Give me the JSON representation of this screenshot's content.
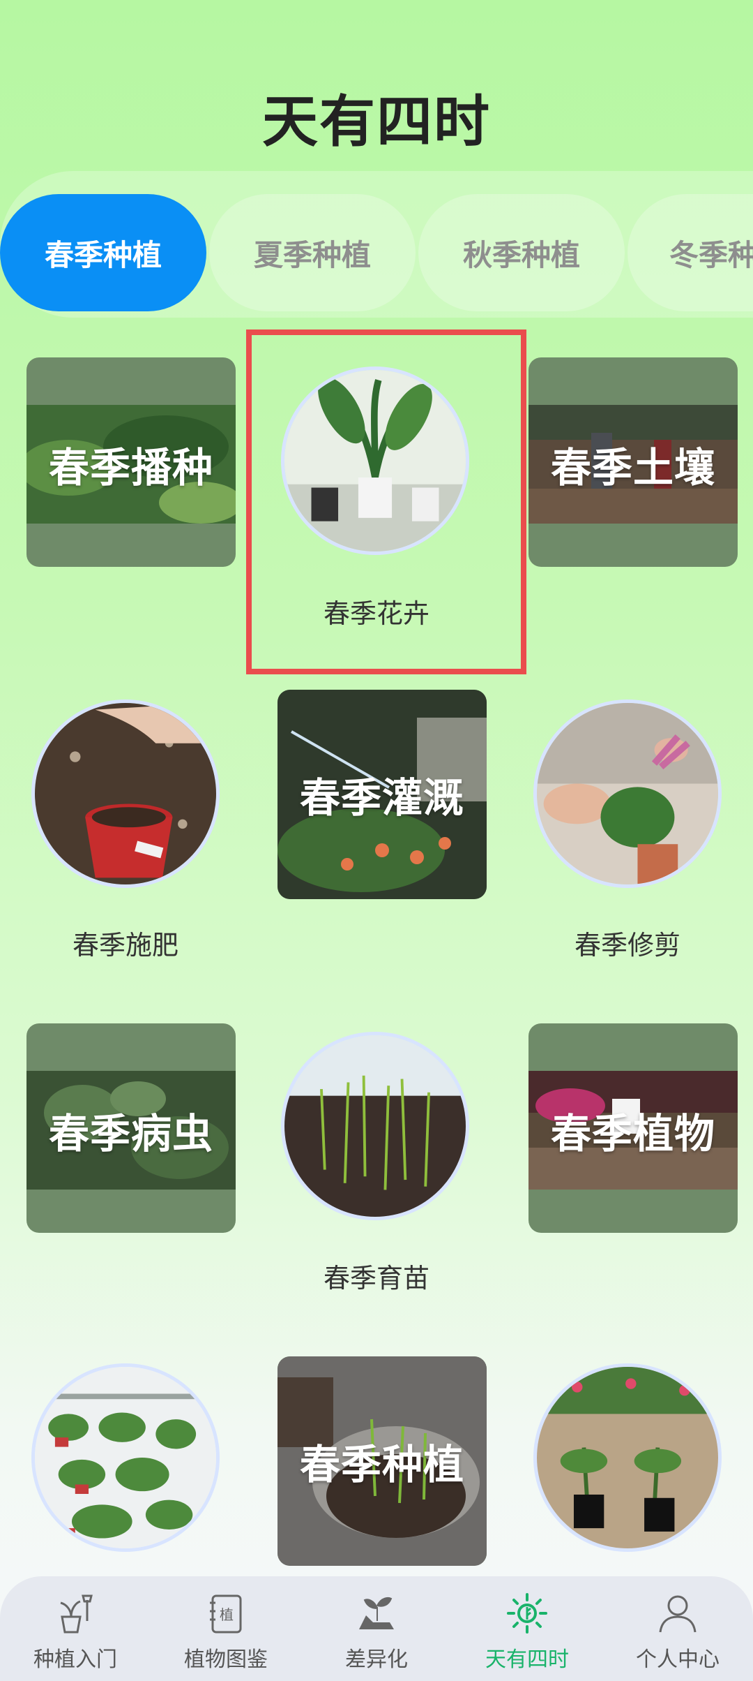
{
  "header": {
    "title": "天有四时"
  },
  "tabs": [
    {
      "label": "春季种植",
      "active": true
    },
    {
      "label": "夏季种植",
      "active": false
    },
    {
      "label": "秋季种植",
      "active": false
    },
    {
      "label": "冬季种植",
      "active": false
    }
  ],
  "grid": {
    "row1": {
      "left": "春季播种",
      "center": "春季花卉",
      "right": "春季土壤"
    },
    "row2": {
      "left": "春季施肥",
      "center": "春季灌溉",
      "right": "春季修剪"
    },
    "row3": {
      "left": "春季病虫",
      "center": "春季育苗",
      "right": "春季植物"
    },
    "row4": {
      "center": "春季种植"
    }
  },
  "bottom_nav": [
    {
      "label": "种植入门",
      "icon": "potted-plant-shovel-icon"
    },
    {
      "label": "植物图鉴",
      "icon": "plant-book-icon"
    },
    {
      "label": "差异化",
      "icon": "sprout-hand-icon"
    },
    {
      "label": "天有四时",
      "icon": "sun-leaf-icon",
      "active": true
    },
    {
      "label": "个人中心",
      "icon": "person-icon"
    }
  ],
  "colors": {
    "active_tab": "#0a8ff5",
    "active_nav": "#19b36a",
    "highlight": "#ea4d4d"
  }
}
